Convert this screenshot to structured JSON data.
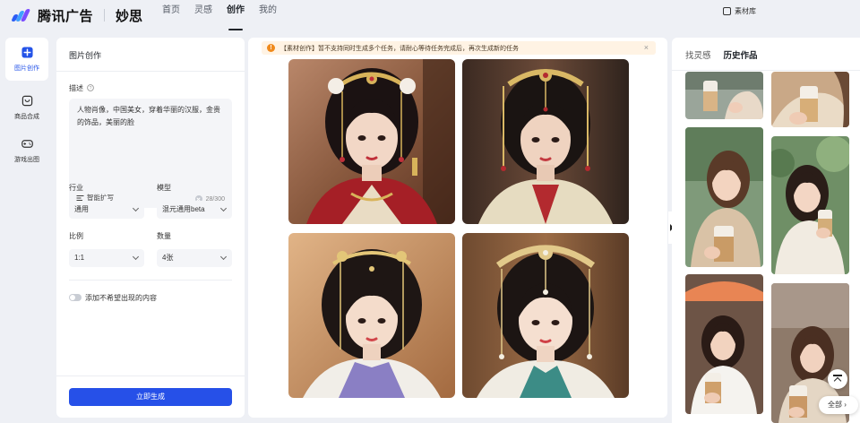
{
  "app": {
    "brand": "腾讯广告",
    "product": "妙思",
    "brand_colors": [
      "#2b5cf5",
      "#3fa0ff",
      "#7a4cff"
    ]
  },
  "nav": {
    "items": [
      {
        "label": "首页",
        "active": false
      },
      {
        "label": "灵感",
        "active": false
      },
      {
        "label": "创作",
        "active": true
      },
      {
        "label": "我的",
        "active": false
      }
    ],
    "material_library": "素材库"
  },
  "sidebar": {
    "items": [
      {
        "label": "图片创作",
        "icon": "image-plus-icon",
        "active": true
      },
      {
        "label": "商品合成",
        "icon": "bag-icon",
        "active": false
      },
      {
        "label": "游戏出图",
        "icon": "gamepad-icon",
        "active": false
      }
    ],
    "accent": "#2453e8"
  },
  "create_panel": {
    "title": "图片创作",
    "description_label": "描述",
    "description_value": "人物肖像，中国美女，穿着华丽的汉服，金贵的饰品，美丽的脸",
    "smart_expand": "智能扩写",
    "char_count": "28/300",
    "industry_label": "行业",
    "industry_value": "通用",
    "model_label": "模型",
    "model_value": "混元通用beta",
    "ratio_label": "比例",
    "ratio_value": "1:1",
    "quantity_label": "数量",
    "quantity_value": "4张",
    "negative_toggle_label": "添加不希望出现的内容",
    "negative_toggle_on": false,
    "generate_button": "立即生成",
    "primary_color": "#2650e8"
  },
  "canvas": {
    "notice": "【素材创作】暂不支持同时生成多个任务，请耐心等待任务完成后，再次生成新的任务",
    "notice_icon": "warning-icon",
    "images": [
      {
        "subject": "hanfu-portrait-red-gold"
      },
      {
        "subject": "hanfu-portrait-cream-red"
      },
      {
        "subject": "hanfu-portrait-white-purple"
      },
      {
        "subject": "hanfu-portrait-teal-gold"
      }
    ]
  },
  "right_panel": {
    "tabs": [
      {
        "label": "找灵感",
        "active": false
      },
      {
        "label": "历史作品",
        "active": true
      }
    ],
    "all_button": "全部",
    "history_items": 6
  }
}
